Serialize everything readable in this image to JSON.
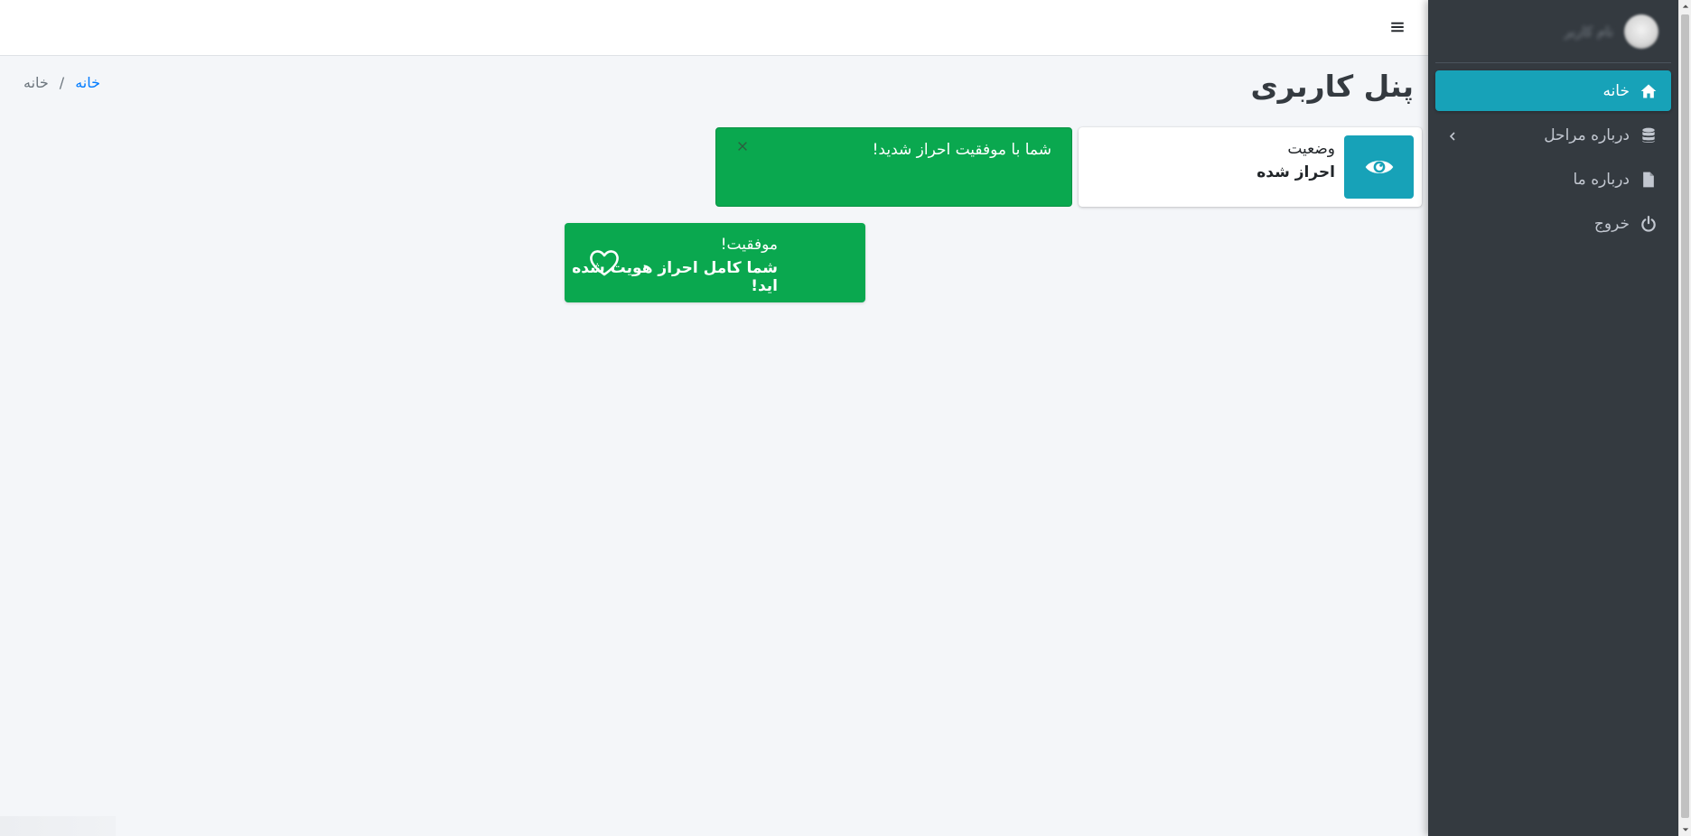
{
  "sidebar": {
    "user_name": "نام کاربر",
    "items": [
      {
        "label": "خانه",
        "icon": "home-icon"
      },
      {
        "label": "درباره مراحل",
        "icon": "database-icon"
      },
      {
        "label": "درباره ما",
        "icon": "file-icon"
      },
      {
        "label": "خروج",
        "icon": "power-icon"
      }
    ]
  },
  "header": {
    "title": "پنل کاربری",
    "breadcrumb": {
      "link": "خانه",
      "separator": "/",
      "active": "خانه"
    }
  },
  "status_box": {
    "label": "وضعیت",
    "value": "احراز شده",
    "icon": "eye-icon"
  },
  "alert": {
    "message": "شما با موفقیت احراز شدید!",
    "close": "×"
  },
  "success_box": {
    "title": "موفقیت!",
    "text": "شما کامل احراز هویت شده اید!",
    "icon": "heart-icon"
  },
  "colors": {
    "sidebar": "#343a40",
    "accent": "#17a2b8",
    "success": "#0aa84f",
    "link": "#007bff",
    "background": "#f4f6f9"
  }
}
